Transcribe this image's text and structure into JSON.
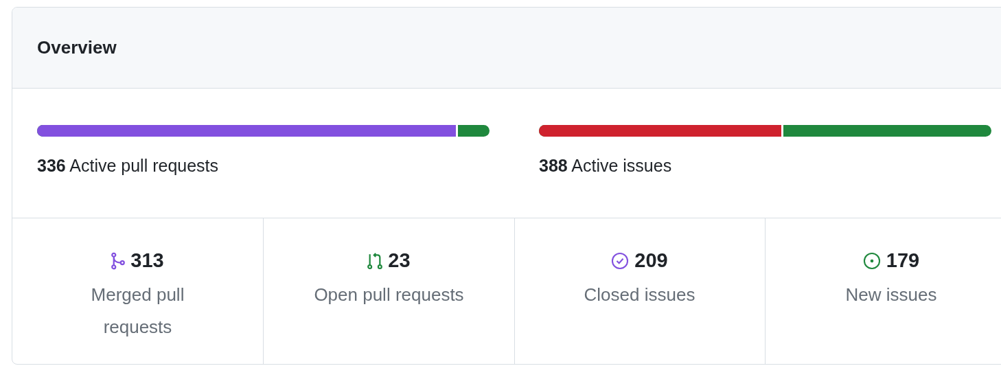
{
  "header": {
    "title": "Overview"
  },
  "progress": [
    {
      "count": "336",
      "label": "Active pull requests",
      "level": 0.93,
      "color": "#8250df"
    },
    {
      "count": "388",
      "label": "Active issues",
      "level": 0.54,
      "color": "#cf222e"
    }
  ],
  "stats": [
    {
      "kind": "merged",
      "value": "313",
      "label": "Merged pull requests"
    },
    {
      "kind": "open-pr",
      "value": "23",
      "label": "Open pull requests"
    },
    {
      "kind": "closed-issue",
      "value": "209",
      "label": "Closed issues"
    },
    {
      "kind": "open-issue",
      "value": "179",
      "label": "New issues"
    }
  ]
}
